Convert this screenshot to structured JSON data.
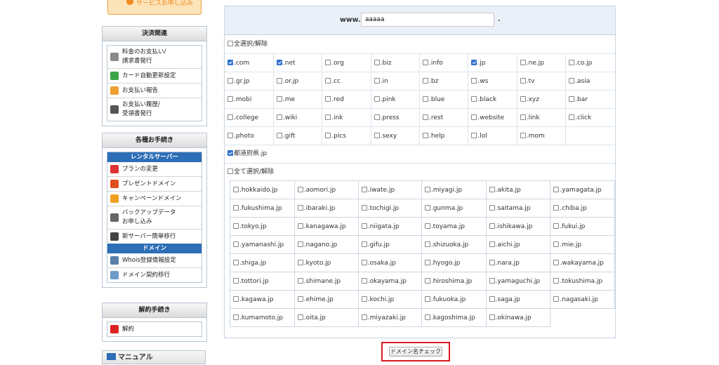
{
  "sidebar": {
    "top_button_label": "サービスお申し込み",
    "billing": {
      "title": "決済関連",
      "items": [
        {
          "label": "料金のお支払い/\n請求書発行",
          "icon": "invoice-icon"
        },
        {
          "label": "カード自動更新設定",
          "icon": "card-icon"
        },
        {
          "label": "お支払い報告",
          "icon": "report-icon"
        },
        {
          "label": "お支払い履歴/\n受領書発行",
          "icon": "history-icon"
        }
      ]
    },
    "procedures": {
      "title": "各種お手続き",
      "rental_header": "レンタルサーバー",
      "rental_items": [
        {
          "label": "プランの変更",
          "icon": "plan-change-icon"
        },
        {
          "label": "プレゼントドメイン",
          "icon": "gift-icon"
        },
        {
          "label": "キャンペーンドメイン",
          "icon": "star-icon"
        },
        {
          "label": "バックアップデータ\nお申し込み",
          "icon": "backup-icon"
        },
        {
          "label": "新サーバー簡単移行",
          "icon": "server-icon"
        }
      ],
      "domain_header": "ドメイン",
      "domain_items": [
        {
          "label": "Whois登録情報設定",
          "icon": "whois-icon"
        },
        {
          "label": "ドメイン契約移行",
          "icon": "transfer-icon"
        }
      ]
    },
    "cancel": {
      "title": "解約手続き",
      "items": [
        {
          "label": "解約",
          "icon": "cancel-icon"
        }
      ]
    },
    "manual_label": "マニュアル"
  },
  "search": {
    "prefix": "www.",
    "value": "aaaaa",
    "suffix": "."
  },
  "tld": {
    "select_all_label": "全選択/解除",
    "rows": [
      [
        {
          "name": ".com",
          "checked": true
        },
        {
          "name": ".net",
          "checked": true
        },
        {
          "name": ".org",
          "checked": false
        },
        {
          "name": ".biz",
          "checked": false
        },
        {
          "name": ".info",
          "checked": false
        },
        {
          "name": ".jp",
          "checked": true
        },
        {
          "name": ".ne.jp",
          "checked": false
        },
        {
          "name": ".co.jp",
          "checked": false
        }
      ],
      [
        {
          "name": ".gr.jp",
          "checked": false
        },
        {
          "name": ".or.jp",
          "checked": false
        },
        {
          "name": ".cc",
          "checked": false
        },
        {
          "name": ".in",
          "checked": false
        },
        {
          "name": ".bz",
          "checked": false
        },
        {
          "name": ".ws",
          "checked": false
        },
        {
          "name": ".tv",
          "checked": false
        },
        {
          "name": ".asia",
          "checked": false
        }
      ],
      [
        {
          "name": ".mobi",
          "checked": false
        },
        {
          "name": ".me",
          "checked": false
        },
        {
          "name": ".red",
          "checked": false
        },
        {
          "name": ".pink",
          "checked": false
        },
        {
          "name": ".blue",
          "checked": false
        },
        {
          "name": ".black",
          "checked": false
        },
        {
          "name": ".xyz",
          "checked": false
        },
        {
          "name": ".bar",
          "checked": false
        }
      ],
      [
        {
          "name": ".college",
          "checked": false
        },
        {
          "name": ".wiki",
          "checked": false
        },
        {
          "name": ".ink",
          "checked": false
        },
        {
          "name": ".press",
          "checked": false
        },
        {
          "name": ".rest",
          "checked": false
        },
        {
          "name": ".website",
          "checked": false
        },
        {
          "name": ".link",
          "checked": false
        },
        {
          "name": ".click",
          "checked": false
        }
      ],
      [
        {
          "name": ".photo",
          "checked": false
        },
        {
          "name": ".gift",
          "checked": false
        },
        {
          "name": ".pics",
          "checked": false
        },
        {
          "name": ".sexy",
          "checked": false
        },
        {
          "name": ".help",
          "checked": false
        },
        {
          "name": ".lol",
          "checked": false
        },
        {
          "name": ".mom",
          "checked": false
        },
        null
      ]
    ]
  },
  "prefecture": {
    "header_label": "都道府県.jp",
    "header_checked": true,
    "select_all_label": "全て選択/解除",
    "rows": [
      [
        ".hokkaido.jp",
        ".aomori.jp",
        ".iwate.jp",
        ".miyagi.jp",
        ".akita.jp",
        ".yamagata.jp"
      ],
      [
        ".fukushima.jp",
        ".ibaraki.jp",
        ".tochigi.jp",
        ".gunma.jp",
        ".saitama.jp",
        ".chiba.jp"
      ],
      [
        ".tokyo.jp",
        ".kanagawa.jp",
        ".niigata.jp",
        ".toyama.jp",
        ".ishikawa.jp",
        ".fukui.jp"
      ],
      [
        ".yamanashi.jp",
        ".nagano.jp",
        ".gifu.jp",
        ".shizuoka.jp",
        ".aichi.jp",
        ".mie.jp"
      ],
      [
        ".shiga.jp",
        ".kyoto.jp",
        ".osaka.jp",
        ".hyogo.jp",
        ".nara.jp",
        ".wakayama.jp"
      ],
      [
        ".tottori.jp",
        ".shimane.jp",
        ".okayama.jp",
        ".hiroshima.jp",
        ".yamaguchi.jp",
        ".tokushima.jp"
      ],
      [
        ".kagawa.jp",
        ".ehime.jp",
        ".kochi.jp",
        ".fukuoka.jp",
        ".saga.jp",
        ".nagasaki.jp"
      ],
      [
        ".kumamoto.jp",
        ".oita.jp",
        ".miyazaki.jp",
        ".kagoshima.jp",
        ".okinawa.jp",
        null
      ]
    ]
  },
  "check_button_label": "ドメイン名チェック",
  "colors": {
    "accent": "#2d6eb7",
    "highlight_border": "#d71920",
    "header_bg": "#e9f0f8"
  }
}
